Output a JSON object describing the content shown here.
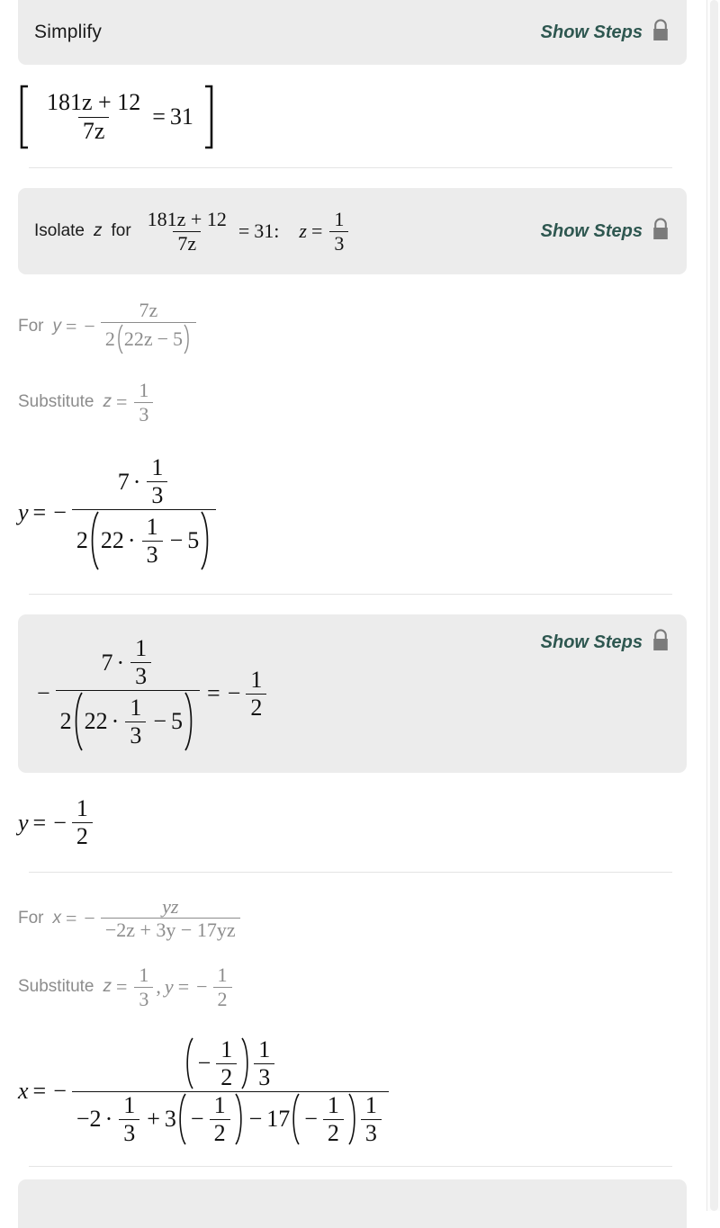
{
  "meta": {
    "app": "math-solver-steps",
    "accent_color": "#2e5750",
    "banner_bg": "#ececec",
    "muted_text": "#8c8c8c",
    "body_text": "#111111"
  },
  "common": {
    "show_steps_label": "Show Steps",
    "lock_icon": "lock-icon"
  },
  "sections": [
    {
      "id": "simplify",
      "type": "banner",
      "title": "Simplify",
      "show_steps": true,
      "locked": true
    },
    {
      "id": "simplify-result",
      "type": "equation",
      "latex": "[ (181z + 12)/(7z) = 31 ]",
      "parts": {
        "numerator": "181z + 12",
        "denominator": "7z",
        "relation": "=",
        "rhs": "31",
        "left_bracket": "[",
        "right_bracket": "]"
      }
    },
    {
      "id": "isolate-z",
      "type": "banner",
      "title": "Isolate z for (181z+12)/(7z) = 31:   z = 1/3",
      "show_steps": true,
      "locked": true,
      "parts": {
        "lead": "Isolate",
        "variable": "z",
        "for_word": "for",
        "numerator": "181z + 12",
        "denominator": "7z",
        "relation": "=",
        "rhs": "31",
        "colon": ":",
        "solution_var": "z",
        "solution_eq": "=",
        "solution_num": "1",
        "solution_den": "3"
      }
    },
    {
      "id": "for-y",
      "type": "note",
      "style": "muted",
      "parts": {
        "lead": "For",
        "variable": "y",
        "relation": "=",
        "sign": "−",
        "numerator": "7z",
        "den_coeff": "2",
        "den_inner_a": "22z",
        "den_inner_op": "−",
        "den_inner_b": "5"
      }
    },
    {
      "id": "substitute-z",
      "type": "note",
      "style": "muted",
      "parts": {
        "lead": "Substitute",
        "variable": "z",
        "relation": "=",
        "value_num": "1",
        "value_den": "3"
      }
    },
    {
      "id": "y-substituted",
      "type": "equation",
      "parts": {
        "lhs": "y",
        "relation": "=",
        "sign": "−",
        "num_coeff": "7",
        "num_dot": "·",
        "num_frac_num": "1",
        "num_frac_den": "3",
        "den_coeff": "2",
        "den_inner_a": "22",
        "den_inner_dot": "·",
        "den_inner_frac_num": "1",
        "den_inner_frac_den": "3",
        "den_inner_op": "−",
        "den_inner_b": "5"
      }
    },
    {
      "id": "evaluate-y",
      "type": "banner",
      "show_steps": true,
      "locked": true,
      "parts": {
        "sign": "−",
        "num_coeff": "7",
        "num_dot": "·",
        "num_frac_num": "1",
        "num_frac_den": "3",
        "den_coeff": "2",
        "den_inner_a": "22",
        "den_inner_dot": "·",
        "den_inner_frac_num": "1",
        "den_inner_frac_den": "3",
        "den_inner_op": "−",
        "den_inner_b": "5",
        "relation": "=",
        "result_sign": "−",
        "result_num": "1",
        "result_den": "2"
      }
    },
    {
      "id": "y-result",
      "type": "equation",
      "parts": {
        "lhs": "y",
        "relation": "=",
        "sign": "−",
        "num": "1",
        "den": "2"
      }
    },
    {
      "id": "for-x",
      "type": "note",
      "style": "muted",
      "parts": {
        "lead": "For",
        "variable": "x",
        "relation": "=",
        "sign": "−",
        "numerator": "yz",
        "denominator": "−2z + 3y − 17yz"
      }
    },
    {
      "id": "substitute-zy",
      "type": "note",
      "style": "muted",
      "parts": {
        "lead": "Substitute",
        "var_z": "z",
        "rel_z": "=",
        "z_num": "1",
        "z_den": "3",
        "comma": ",",
        "var_y": "y",
        "rel_y": "=",
        "y_sign": "−",
        "y_num": "1",
        "y_den": "2"
      }
    },
    {
      "id": "x-substituted",
      "type": "equation",
      "parts": {
        "lhs": "x",
        "relation": "=",
        "sign": "−",
        "num_p_sign": "−",
        "num_p_num": "1",
        "num_p_den": "2",
        "num_frac_num": "1",
        "num_frac_den": "3",
        "den_t1_sign": "−2",
        "den_t1_dot": "·",
        "den_t1_num": "1",
        "den_t1_den": "3",
        "den_op1": "+",
        "den_t2_coeff": "3",
        "den_t2_sign": "−",
        "den_t2_num": "1",
        "den_t2_den": "2",
        "den_op2": "−",
        "den_t3_coeff": "17",
        "den_t3_sign": "−",
        "den_t3_num": "1",
        "den_t3_den": "2",
        "den_t3_fnum": "1",
        "den_t3_fden": "3"
      }
    }
  ]
}
